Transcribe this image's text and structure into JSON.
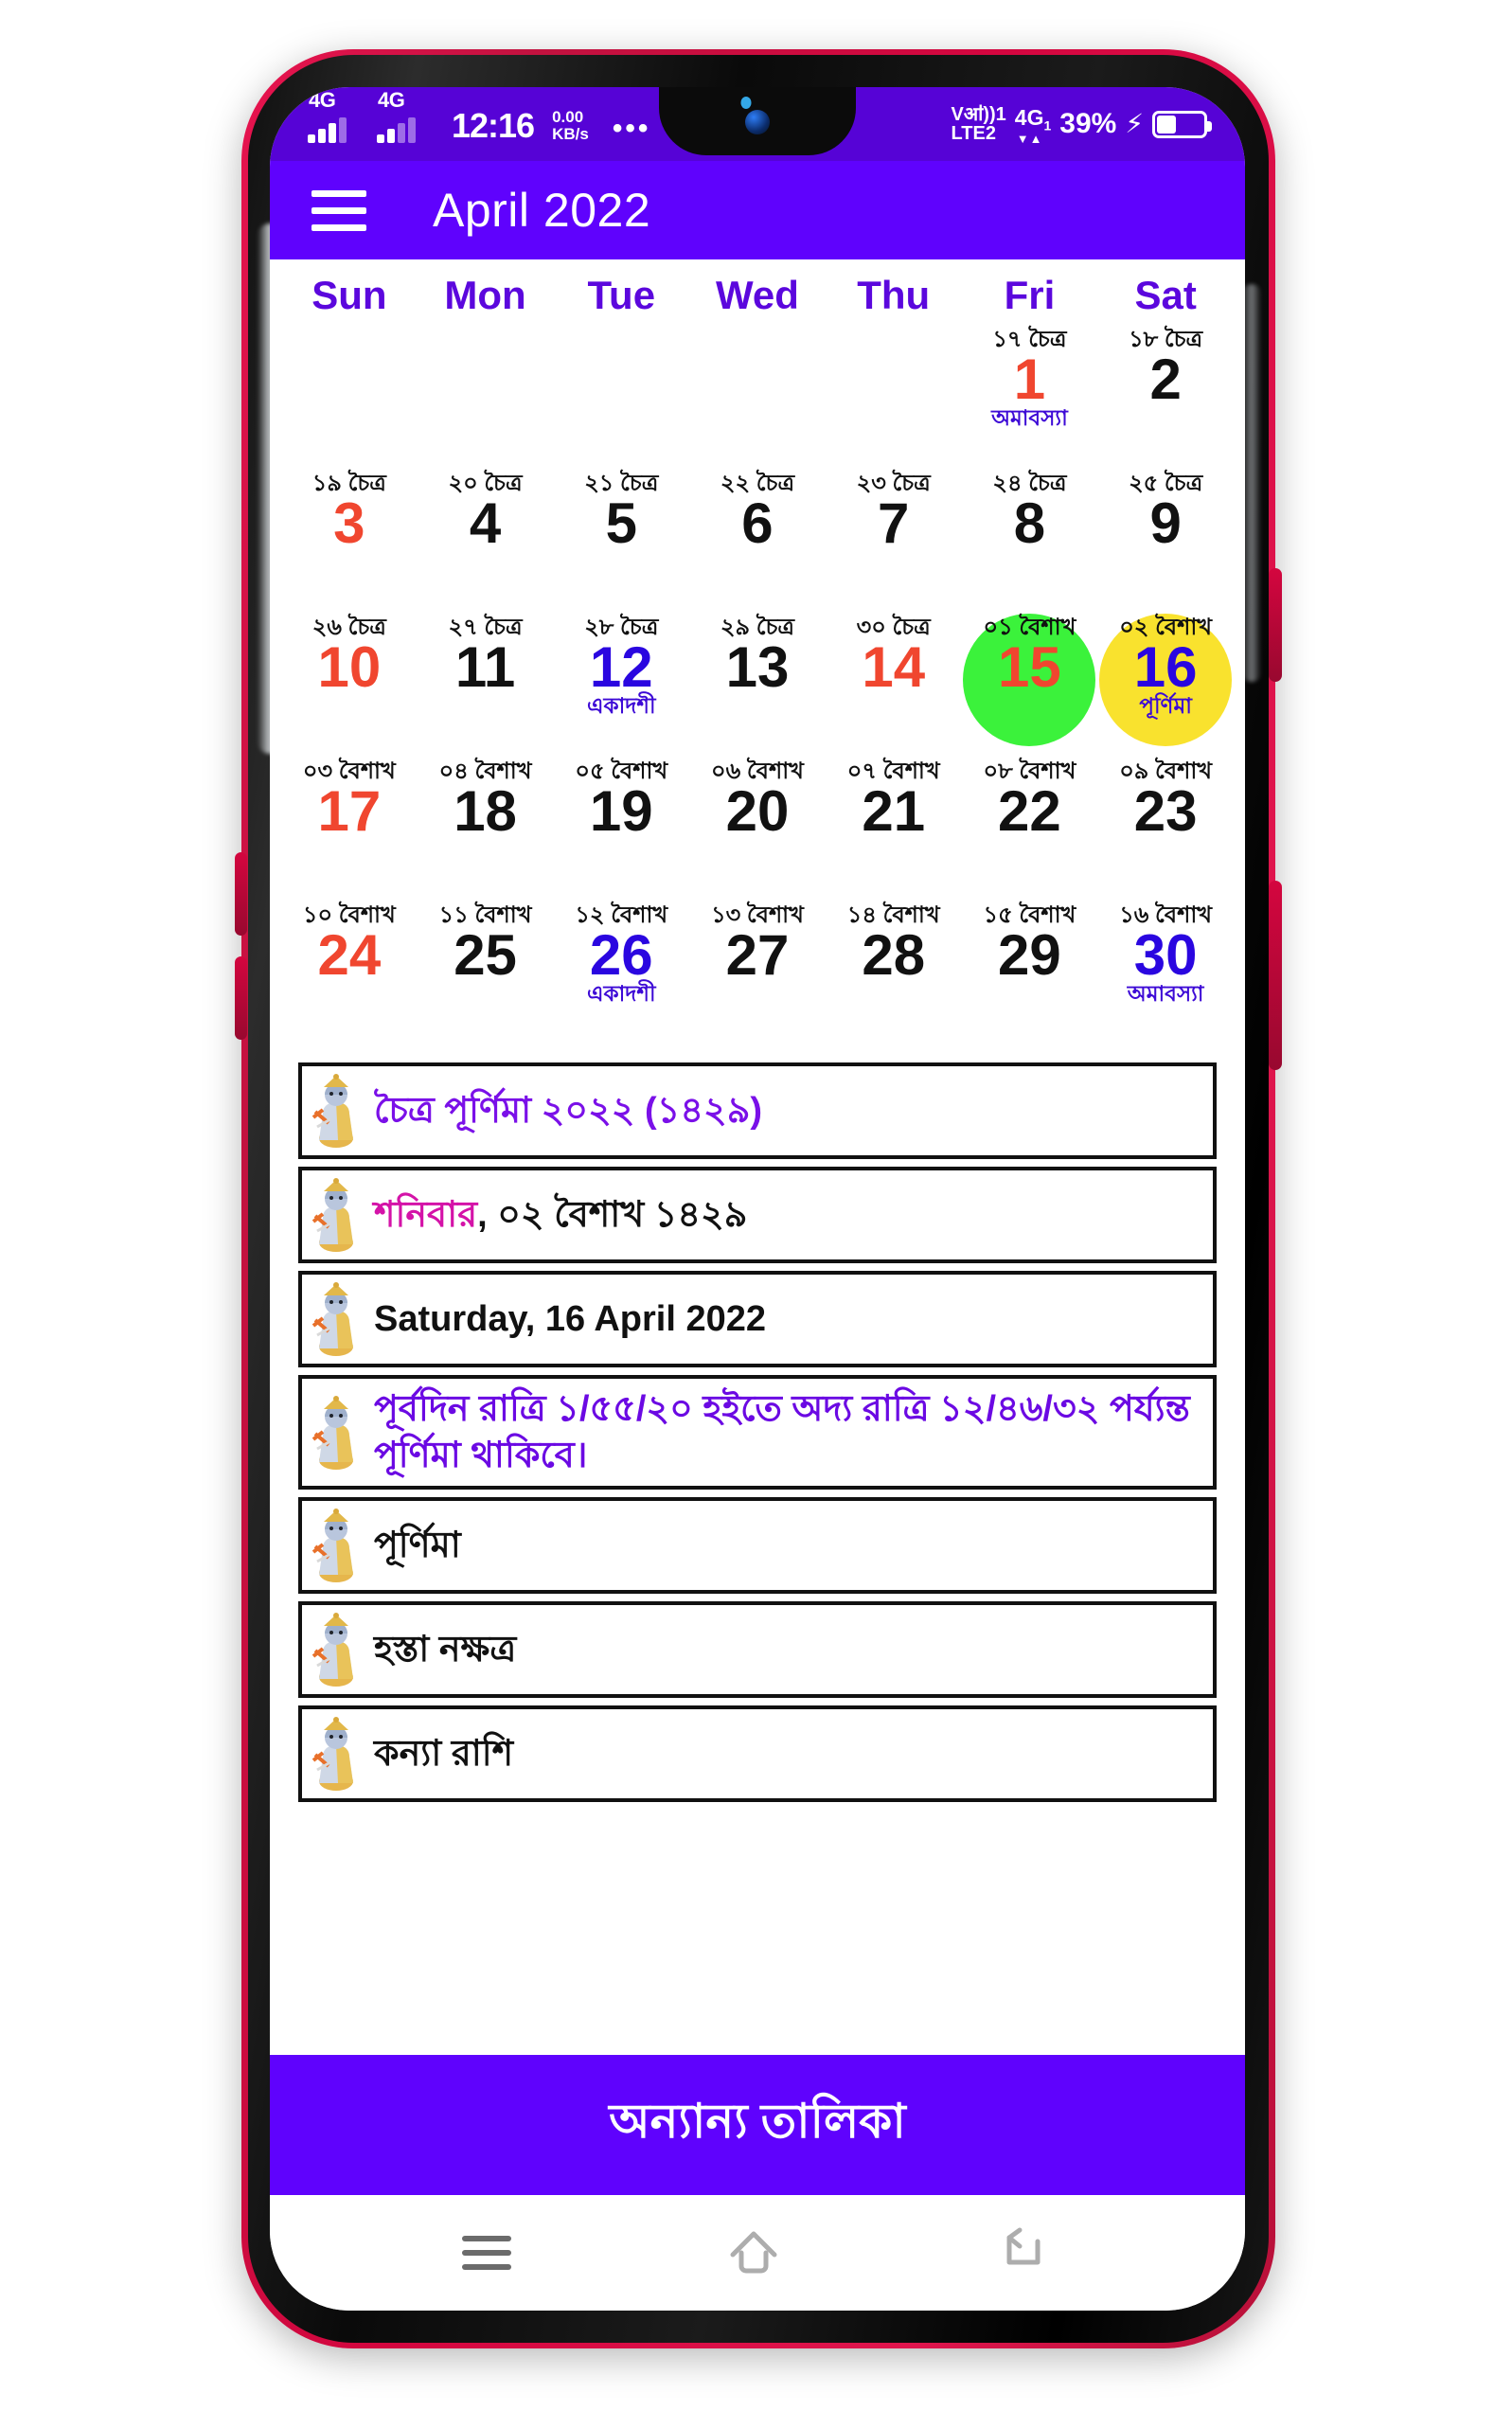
{
  "status_bar": {
    "sim1_network": "4G",
    "sim2_network": "4G",
    "time": "12:16",
    "net_speed_value": "0.00",
    "net_speed_unit": "KB/s",
    "overflow": "•••",
    "volte_line1": "Vॴ))1",
    "volte_line2": "LTE2",
    "data_network": "4G",
    "data_network_sub": "1",
    "battery_percent": "39%",
    "charging_glyph": "⚡"
  },
  "app_bar": {
    "menu_icon": "hamburger-menu-icon",
    "title": "April 2022"
  },
  "calendar": {
    "weekdays": [
      "Sun",
      "Mon",
      "Tue",
      "Wed",
      "Thu",
      "Fri",
      "Sat"
    ],
    "weekday_color": "#5b07dd",
    "highlight_colors": {
      "today": "#3bf23b",
      "selected": "#f9e22e"
    },
    "weeks": [
      [
        {
          "blank": true
        },
        {
          "blank": true
        },
        {
          "blank": true
        },
        {
          "blank": true
        },
        {
          "blank": true
        },
        {
          "bengali": "১৭ চৈত্র",
          "day": "1",
          "color": "red",
          "tithi": "অমাবস্যা"
        },
        {
          "bengali": "১৮ চৈত্র",
          "day": "2",
          "color": "black",
          "tithi": ""
        }
      ],
      [
        {
          "bengali": "১৯ চৈত্র",
          "day": "3",
          "color": "red",
          "tithi": ""
        },
        {
          "bengali": "২০ চৈত্র",
          "day": "4",
          "color": "black",
          "tithi": ""
        },
        {
          "bengali": "২১ চৈত্র",
          "day": "5",
          "color": "black",
          "tithi": ""
        },
        {
          "bengali": "২২ চৈত্র",
          "day": "6",
          "color": "black",
          "tithi": ""
        },
        {
          "bengali": "২৩ চৈত্র",
          "day": "7",
          "color": "black",
          "tithi": ""
        },
        {
          "bengali": "২৪ চৈত্র",
          "day": "8",
          "color": "black",
          "tithi": ""
        },
        {
          "bengali": "২৫ চৈত্র",
          "day": "9",
          "color": "black",
          "tithi": ""
        }
      ],
      [
        {
          "bengali": "২৬ চৈত্র",
          "day": "10",
          "color": "red",
          "tithi": ""
        },
        {
          "bengali": "২৭ চৈত্র",
          "day": "11",
          "color": "black",
          "tithi": ""
        },
        {
          "bengali": "২৮ চৈত্র",
          "day": "12",
          "color": "blue",
          "tithi": "একাদশী"
        },
        {
          "bengali": "২৯ চৈত্র",
          "day": "13",
          "color": "black",
          "tithi": ""
        },
        {
          "bengali": "৩০ চৈত্র",
          "day": "14",
          "color": "red",
          "tithi": ""
        },
        {
          "bengali": "০১ বৈশাখ",
          "day": "15",
          "color": "red",
          "tithi": "",
          "circle": "green"
        },
        {
          "bengali": "০২ বৈশাখ",
          "day": "16",
          "color": "blue",
          "tithi": "পূর্ণিমা",
          "circle": "yellow"
        }
      ],
      [
        {
          "bengali": "০৩ বৈশাখ",
          "day": "17",
          "color": "red",
          "tithi": ""
        },
        {
          "bengali": "০৪ বৈশাখ",
          "day": "18",
          "color": "black",
          "tithi": ""
        },
        {
          "bengali": "০৫ বৈশাখ",
          "day": "19",
          "color": "black",
          "tithi": ""
        },
        {
          "bengali": "০৬ বৈশাখ",
          "day": "20",
          "color": "black",
          "tithi": ""
        },
        {
          "bengali": "০৭ বৈশাখ",
          "day": "21",
          "color": "black",
          "tithi": ""
        },
        {
          "bengali": "০৮ বৈশাখ",
          "day": "22",
          "color": "black",
          "tithi": ""
        },
        {
          "bengali": "০৯ বৈশাখ",
          "day": "23",
          "color": "black",
          "tithi": ""
        }
      ],
      [
        {
          "bengali": "১০ বৈশাখ",
          "day": "24",
          "color": "red",
          "tithi": ""
        },
        {
          "bengali": "১১ বৈশাখ",
          "day": "25",
          "color": "black",
          "tithi": ""
        },
        {
          "bengali": "১২ বৈশাখ",
          "day": "26",
          "color": "blue",
          "tithi": "একাদশী"
        },
        {
          "bengali": "১৩ বৈশাখ",
          "day": "27",
          "color": "black",
          "tithi": ""
        },
        {
          "bengali": "১৪ বৈশাখ",
          "day": "28",
          "color": "black",
          "tithi": ""
        },
        {
          "bengali": "১৫ বৈশাখ",
          "day": "29",
          "color": "black",
          "tithi": ""
        },
        {
          "bengali": "১৬ বৈশাখ",
          "day": "30",
          "color": "blue",
          "tithi": "অমাবস্যা"
        }
      ]
    ]
  },
  "info_list": [
    {
      "icon": "krishna-icon",
      "text": "চৈত্র পূর্ণিমা ২০২২ (১৪২৯)",
      "style": "purple"
    },
    {
      "icon": "krishna-icon",
      "text_parts": [
        {
          "t": "শনিবার",
          "c": "magenta"
        },
        {
          "t": ", ০২ বৈশাখ ১৪২৯",
          "c": "dark"
        }
      ],
      "style": "mixed"
    },
    {
      "icon": "krishna-icon",
      "text": "Saturday, 16 April 2022",
      "style": "dark"
    },
    {
      "icon": "krishna-icon",
      "text": "পূর্বদিন রাত্রি ১/৫৫/২০ হইতে অদ্য রাত্রি ১২/৪৬/৩২ পর্য্যন্ত পূর্ণিমা থাকিবে।",
      "style": "violet"
    },
    {
      "icon": "krishna-icon",
      "text": "পূর্ণিমা",
      "style": "dark"
    },
    {
      "icon": "krishna-icon",
      "text": "হস্তা নক্ষত্র",
      "style": "dark"
    },
    {
      "icon": "krishna-icon",
      "text": "কন্যা রাশি",
      "style": "dark"
    }
  ],
  "cta": {
    "label": "অন্যান্য তালিকা"
  },
  "nav_bar": {
    "recents": "recents-icon",
    "home": "home-icon",
    "back": "back-icon"
  },
  "colors": {
    "app_bar": "#5f02fd",
    "status_bar": "#5603d6",
    "weekday": "#5b07dd",
    "sunday": "#f0462f",
    "tithi": "#3d0ad6",
    "today_circle": "#3bf23b",
    "selected_circle": "#f9e22e",
    "phone_frame": "#d4063f"
  }
}
